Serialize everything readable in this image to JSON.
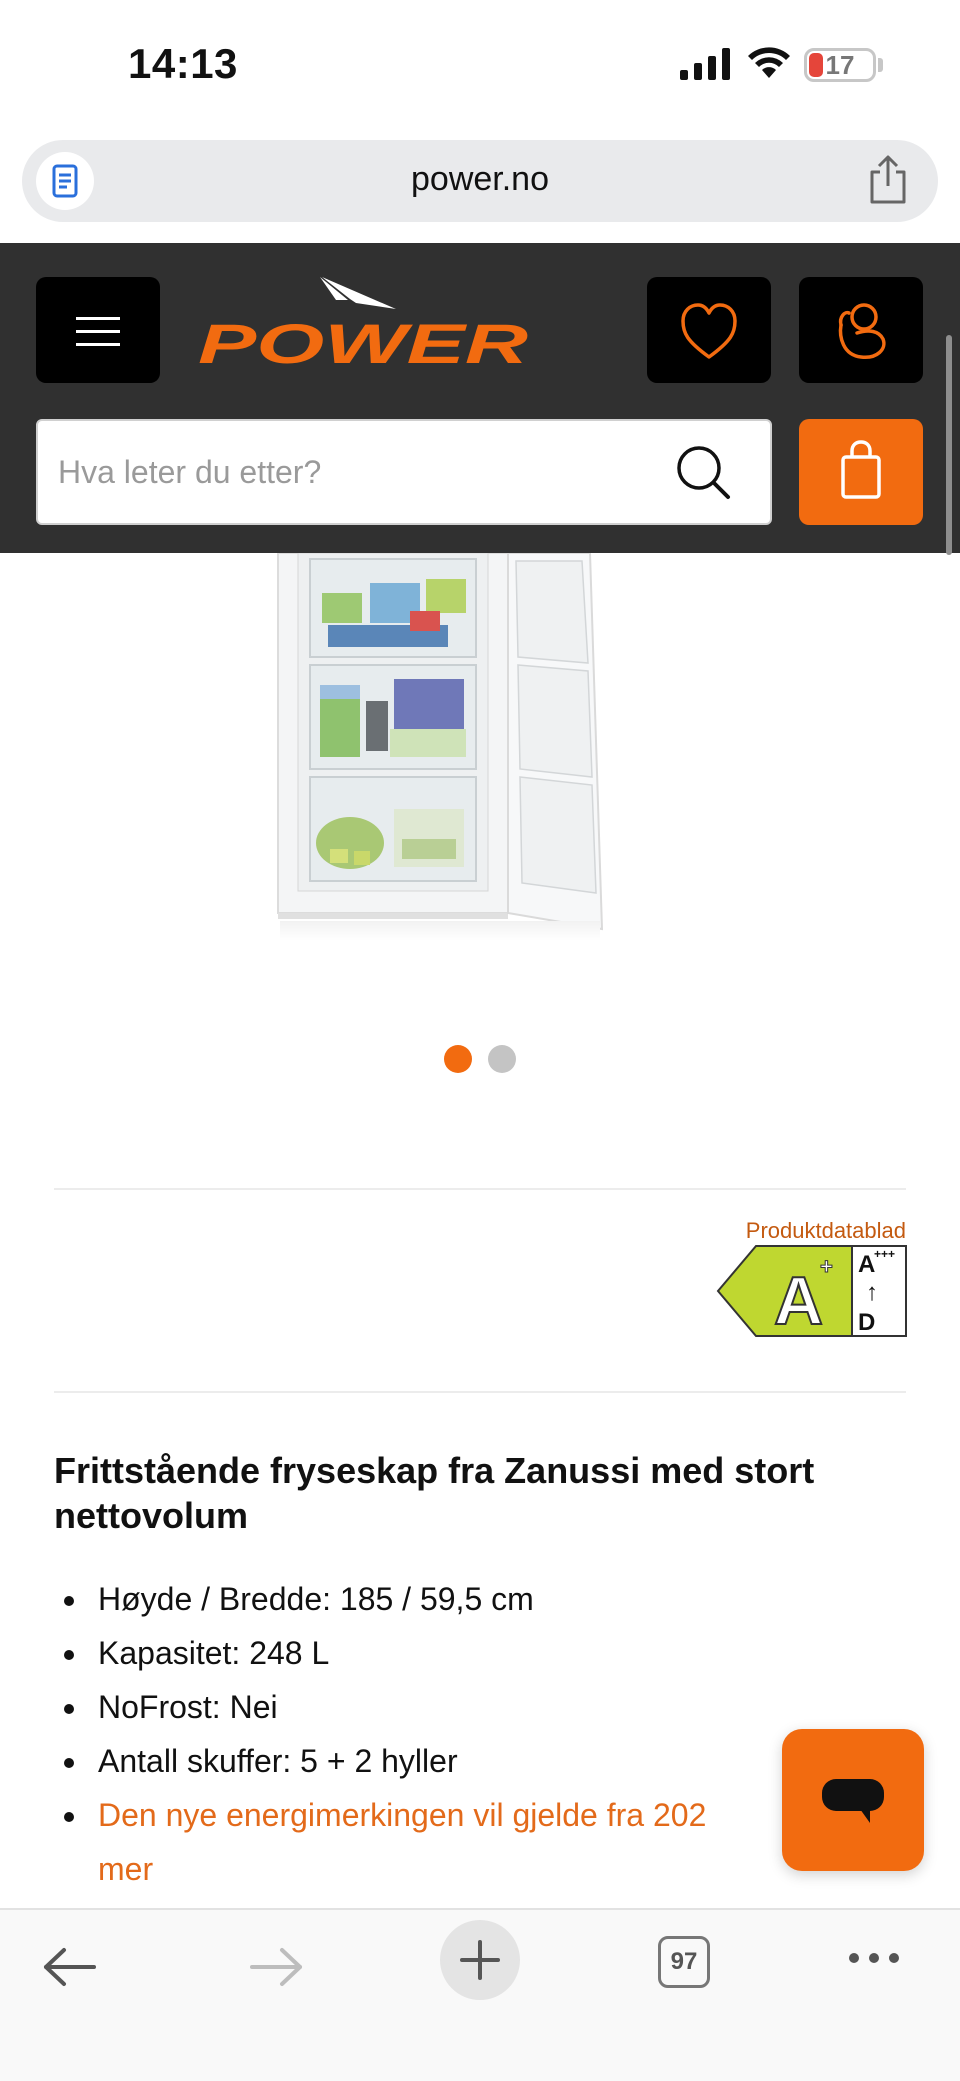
{
  "status_bar": {
    "time": "14:13",
    "battery": "17"
  },
  "browser": {
    "url": "power.no",
    "tab_count": "97"
  },
  "header": {
    "logo_text": "POWER",
    "search_placeholder": "Hva leter du etter?"
  },
  "carousel": {
    "image_count": 2,
    "active_index": 0
  },
  "energy": {
    "datasheet_label": "Produktdatablad",
    "class": "A",
    "class_suffix": "+",
    "scale_top": "A",
    "scale_top_suffix": "+++",
    "scale_arrow": "↑",
    "scale_bottom": "D"
  },
  "product": {
    "title": "Frittstående fryseskap fra Zanussi med stort nettovolum",
    "features": [
      "Høyde / Bredde: 185 / 59,5 cm",
      "Kapasitet: 248 L",
      "NoFrost: Nei",
      "Antall skuffer: 5 + 2 hyller"
    ],
    "energy_note": "Den nye energimerkingen vil gjelde fra 202",
    "energy_note_more": "mer"
  },
  "colors": {
    "brand": "#f26b10",
    "header_bg": "#303030",
    "energy_green": "#bfd730"
  },
  "icons": [
    "reader-icon",
    "share-icon",
    "menu-icon",
    "heart-icon",
    "account-icon",
    "search-icon",
    "cart-icon",
    "chat-icon",
    "back-icon",
    "forward-icon",
    "plus-icon",
    "more-icon"
  ]
}
